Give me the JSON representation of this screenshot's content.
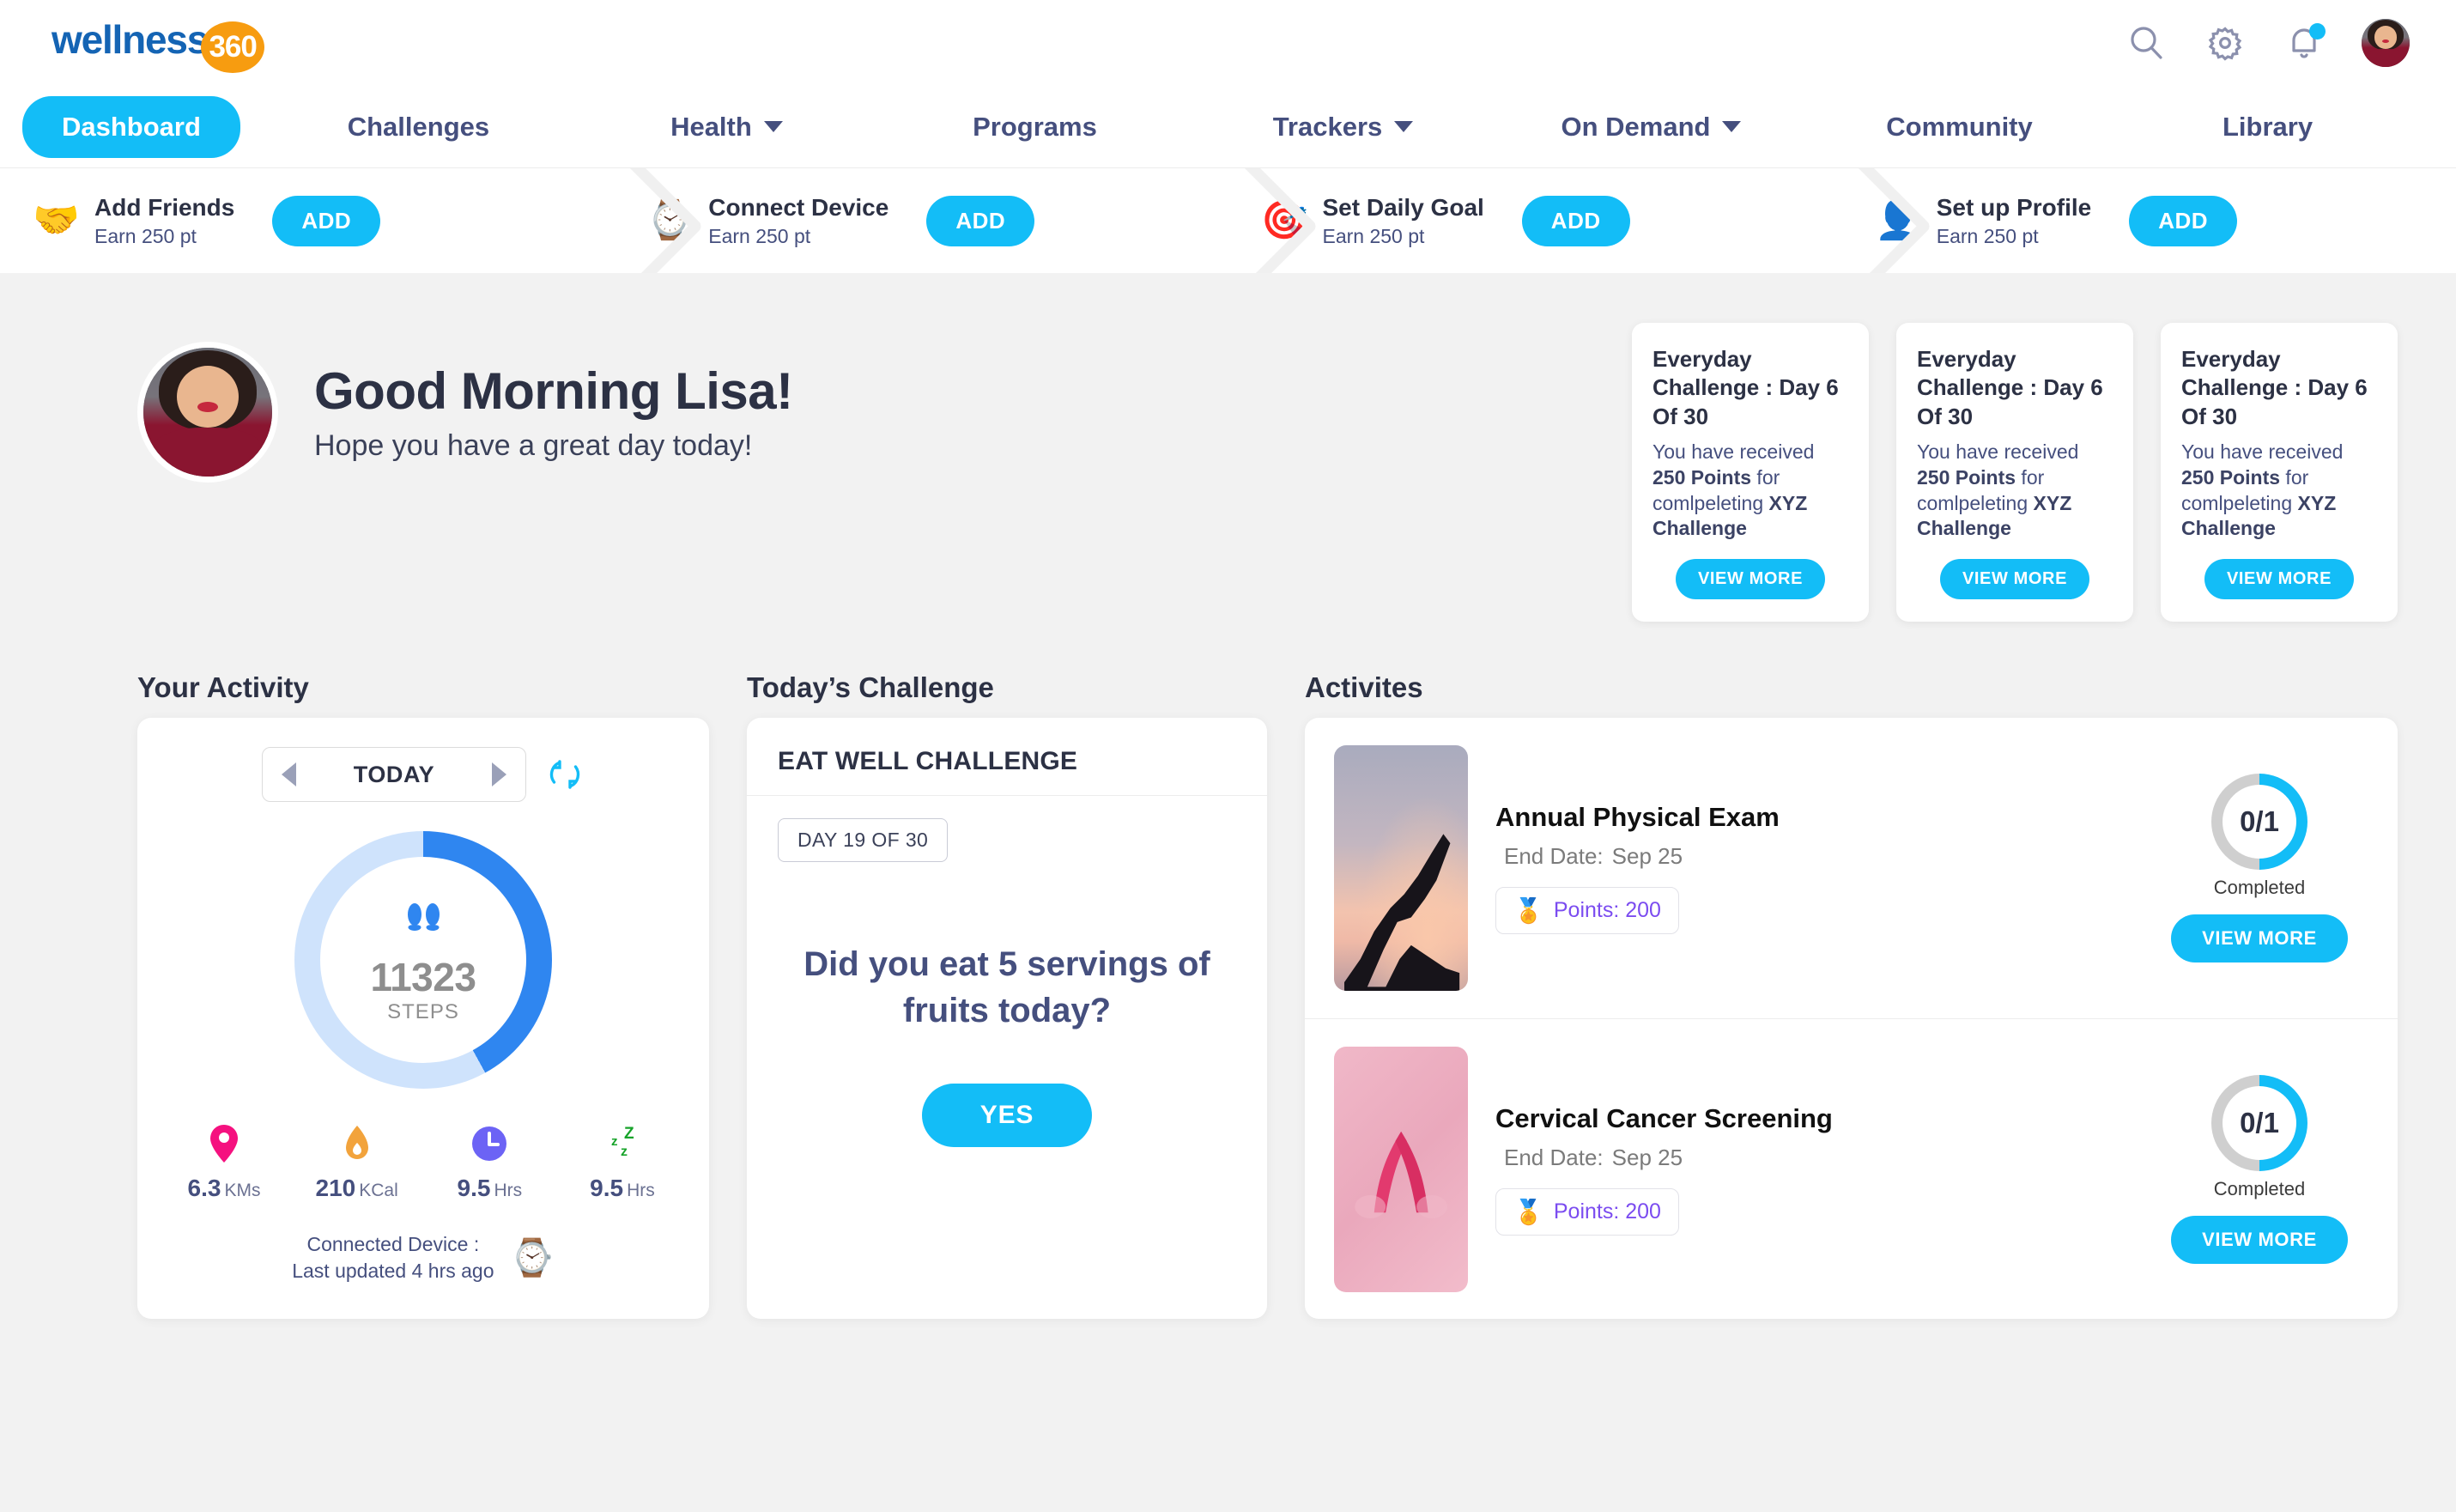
{
  "brand": {
    "word": "wellness",
    "badge": "360"
  },
  "topbar": {
    "icons": [
      {
        "name": "search-icon",
        "label": "Search"
      },
      {
        "name": "gear-icon",
        "label": "Settings"
      },
      {
        "name": "bell-icon",
        "label": "Notifications"
      }
    ],
    "avatar_alt": "Lisa profile photo"
  },
  "nav": {
    "items": [
      {
        "label": "Dashboard",
        "active": true,
        "caret": false
      },
      {
        "label": "Challenges",
        "active": false,
        "caret": false
      },
      {
        "label": "Health",
        "active": false,
        "caret": true
      },
      {
        "label": "Programs",
        "active": false,
        "caret": false
      },
      {
        "label": "Trackers",
        "active": false,
        "caret": true
      },
      {
        "label": "On Demand",
        "active": false,
        "caret": true
      },
      {
        "label": "Community",
        "active": false,
        "caret": false
      },
      {
        "label": "Library",
        "active": false,
        "caret": false
      }
    ]
  },
  "onboarding": {
    "steps": [
      {
        "emoji": "🤝",
        "icon_name": "handshake-icon",
        "title": "Add Friends",
        "sub": "Earn 250 pt",
        "button": "ADD"
      },
      {
        "emoji": "⌚",
        "icon_name": "watch-icon",
        "title": "Connect Device",
        "sub": "Earn 250 pt",
        "button": "ADD"
      },
      {
        "emoji": "🎯",
        "icon_name": "target-icon",
        "title": "Set Daily Goal",
        "sub": "Earn 250 pt",
        "button": "ADD"
      },
      {
        "emoji": "👤",
        "icon_name": "person-icon",
        "title": "Set up Profile",
        "sub": "Earn 250 pt",
        "button": "ADD"
      }
    ]
  },
  "hero": {
    "greeting": "Good Morning Lisa!",
    "subtitle": "Hope you have a great day today!",
    "avatar_alt": "Lisa"
  },
  "challenge_cards": [
    {
      "title": "Everyday Challenge : Day 6 Of 30",
      "body_prefix": "You have received ",
      "body_points": "250 Points",
      "body_middle": " for comlpeleting ",
      "body_challenge": "XYZ Challenge",
      "button": "VIEW MORE"
    },
    {
      "title": "Everyday Challenge : Day 6 Of 30",
      "body_prefix": "You have received ",
      "body_points": "250 Points",
      "body_middle": " for comlpeleting ",
      "body_challenge": "XYZ Challenge",
      "button": "VIEW MORE"
    },
    {
      "title": "Everyday Challenge : Day 6 Of 30",
      "body_prefix": "You have received ",
      "body_points": "250 Points",
      "body_middle": " for comlpeleting ",
      "body_challenge": "XYZ Challenge",
      "button": "VIEW MORE"
    }
  ],
  "activity": {
    "heading": "Your Activity",
    "day_label": "TODAY",
    "refresh_icon": "refresh-icon",
    "steps_value": "11323",
    "steps_label": "STEPS",
    "steps_percent": 42,
    "stats": [
      {
        "icon": "location-pin-icon",
        "color": "#f5117f",
        "value": "6.3",
        "unit": "KMs"
      },
      {
        "icon": "flame-icon",
        "color": "#f2a33c",
        "value": "210",
        "unit": "KCal"
      },
      {
        "icon": "clock-icon",
        "color": "#6c63f5",
        "value": "9.5",
        "unit": "Hrs"
      },
      {
        "icon": "sleep-zzz-icon",
        "color": "#17a32a",
        "value": "9.5",
        "unit": "Hrs"
      }
    ],
    "device_line1": "Connected Device :",
    "device_line2": "Last updated 4 hrs ago",
    "device_icon": "watch-icon"
  },
  "todays_challenge": {
    "heading": "Today’s Challenge",
    "name": "EAT WELL CHALLENGE",
    "day_badge": "DAY 19 OF 30",
    "question": "Did you eat 5 servings of fruits today?",
    "button": "YES"
  },
  "activities": {
    "heading": "Activites",
    "items": [
      {
        "title": "Annual Physical Exam",
        "date_label": "End Date:",
        "date_value": "Sep 25",
        "points_label": "Points: 200",
        "medal_icon": "medal-icon",
        "progress": "0/1",
        "progress_caption": "Completed",
        "progress_percent": 50,
        "button": "VIEW MORE",
        "thumb": "yoga-sunset-photo"
      },
      {
        "title": "Cervical Cancer Screening",
        "date_label": "End Date:",
        "date_value": "Sep 25",
        "points_label": "Points: 200",
        "medal_icon": "medal-icon",
        "progress": "0/1",
        "progress_caption": "Completed",
        "progress_percent": 50,
        "button": "VIEW MORE",
        "thumb": "pink-ribbon-photo"
      }
    ]
  },
  "colors": {
    "accent_cyan": "#13bdf7",
    "brand_blue": "#1464b4",
    "brand_orange": "#f79c10",
    "nav_text": "#454f7e",
    "steps_ring": "#2f86f0",
    "points_purple": "#7b4cf0"
  }
}
